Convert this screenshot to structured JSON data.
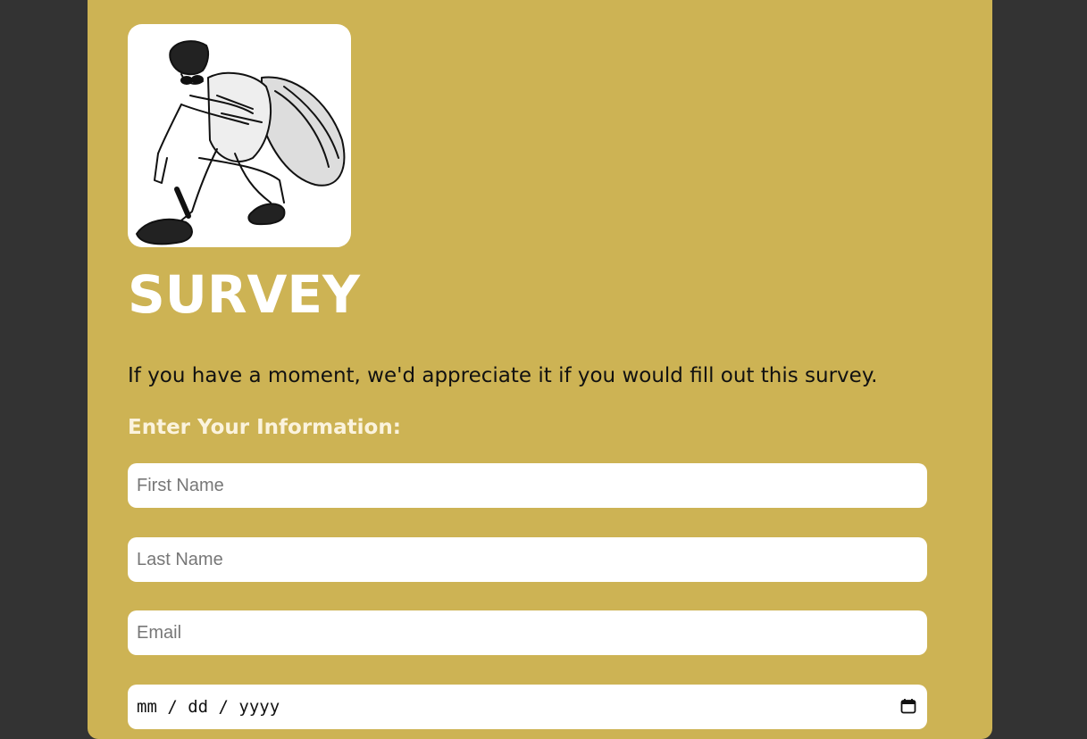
{
  "survey": {
    "title": "SURVEY",
    "intro": "If you have a moment, we'd appreciate it if you would fill out this survey.",
    "section_label": "Enter Your Information:",
    "fields": {
      "first_name_placeholder": "First Name",
      "last_name_placeholder": "Last Name",
      "email_placeholder": "Email",
      "date_placeholder": "mm / dd / yyyy"
    },
    "avatar_description_icon": "sketch-avatar-image"
  },
  "colors": {
    "background": "#333333",
    "card": "#cdb354",
    "title": "#ffffff",
    "section_label": "#fbf3dd",
    "intro_text": "#111111"
  }
}
